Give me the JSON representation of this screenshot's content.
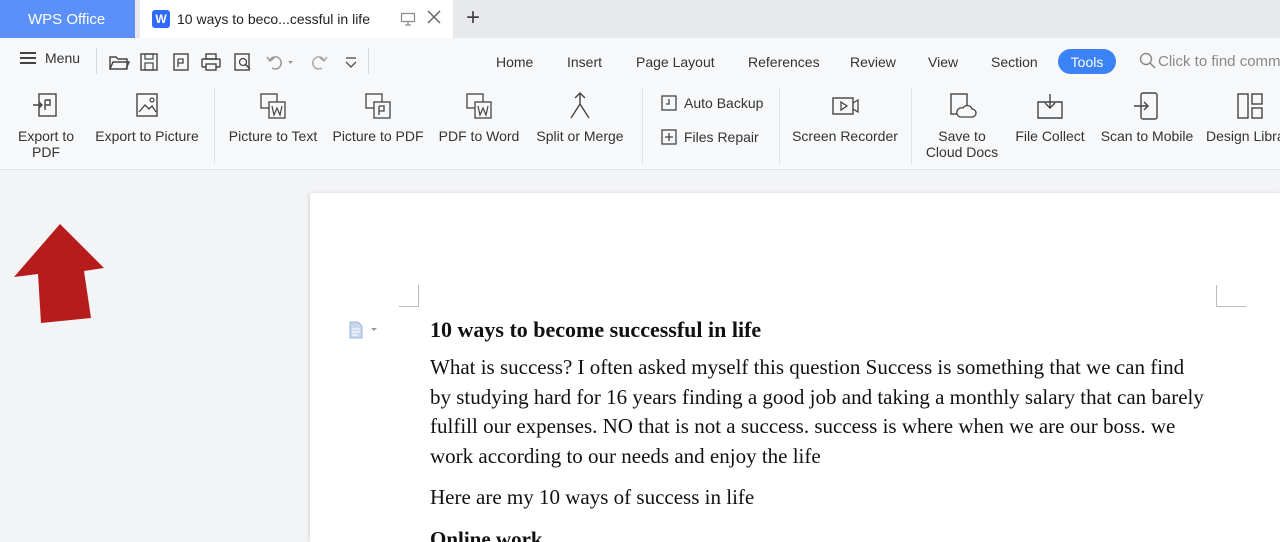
{
  "tabs": {
    "app_label": "WPS Office",
    "doc_icon_letter": "W",
    "doc_title": "10 ways to beco...cessful in life",
    "add_label": "+"
  },
  "menubar": {
    "menu_label": "Menu",
    "nav": [
      "Home",
      "Insert",
      "Page Layout",
      "References",
      "Review",
      "View",
      "Section"
    ],
    "active_tab": "Tools",
    "search_placeholder": "Click to find commands"
  },
  "ribbon": {
    "export_pdf": "Export to PDF",
    "export_picture": "Export to Picture",
    "picture_to_text": "Picture to Text",
    "picture_to_pdf": "Picture to PDF",
    "pdf_to_word": "PDF to Word",
    "split_merge": "Split or Merge",
    "auto_backup": "Auto Backup",
    "files_repair": "Files Repair",
    "screen_recorder": "Screen Recorder",
    "save_cloud": "Save to Cloud Docs",
    "file_collect": "File Collect",
    "scan_mobile": "Scan to Mobile",
    "design_lib": "Design Library"
  },
  "document": {
    "title": "10 ways to become successful in life",
    "p1": "What is success? I often asked myself this question Success is something that we can find by studying hard for 16 years finding a good job and taking a monthly salary that can barely fulfill our expenses.  NO that is not a success. success is where when we are our boss. we work according to our needs and enjoy the life",
    "p2": "Here are my 10 ways of success in life",
    "h2": "Online work"
  },
  "colors": {
    "wps_tab": "#5b8ff9",
    "accent": "#3b82f6",
    "arrow": "#b71c1c"
  }
}
